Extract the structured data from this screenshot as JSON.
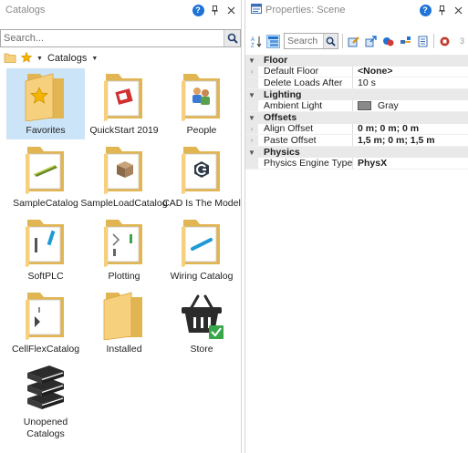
{
  "catalogs_panel": {
    "title": "Catalogs",
    "search_placeholder": "Search...",
    "breadcrumb_label": "Catalogs",
    "items": [
      {
        "label": "Favorites"
      },
      {
        "label": "QuickStart 2019"
      },
      {
        "label": "People"
      },
      {
        "label": "SampleCatalog"
      },
      {
        "label": "SampleLoadCatalog"
      },
      {
        "label": "CAD Is The Model"
      },
      {
        "label": "SoftPLC"
      },
      {
        "label": "Plotting"
      },
      {
        "label": "Wiring Catalog"
      },
      {
        "label": "CellFlexCatalog"
      },
      {
        "label": "Installed"
      },
      {
        "label": "Store"
      },
      {
        "label": "Unopened Catalogs"
      }
    ]
  },
  "properties_panel": {
    "title": "Properties: Scene",
    "search_placeholder": "Search",
    "rows": [
      {
        "type": "category",
        "name": "Floor"
      },
      {
        "type": "prop",
        "name": "Default Floor",
        "value": "<None>",
        "bold": true,
        "expandable": true
      },
      {
        "type": "prop",
        "name": "Delete Loads After",
        "value": "10 s",
        "bold": false
      },
      {
        "type": "category",
        "name": "Lighting"
      },
      {
        "type": "prop",
        "name": "Ambient Light",
        "value": "Gray",
        "bold": false,
        "swatch": "#8a8a8a"
      },
      {
        "type": "category",
        "name": "Offsets"
      },
      {
        "type": "prop",
        "name": "Align Offset",
        "value": "0 m; 0 m; 0 m",
        "bold": true,
        "expandable": true
      },
      {
        "type": "prop",
        "name": "Paste Offset",
        "value": "1,5 m; 0 m; 1,5 m",
        "bold": true,
        "expandable": true
      },
      {
        "type": "category",
        "name": "Physics"
      },
      {
        "type": "prop",
        "name": "Physics Engine Type",
        "value": "PhysX",
        "bold": true
      }
    ]
  },
  "colors": {
    "selection": "#cce4f7",
    "folder": "#f7d07e",
    "folder_dark": "#e2b553",
    "accent_blue": "#1e73d6",
    "check_green": "#3aa64a"
  }
}
